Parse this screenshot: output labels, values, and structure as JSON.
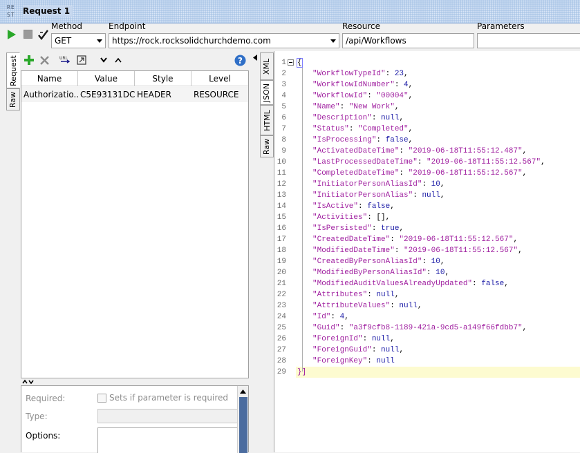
{
  "window": {
    "logo_lines": [
      "RE",
      "ST"
    ],
    "title": "Request 1"
  },
  "request_line": {
    "method_label": "Method",
    "method_value": "GET",
    "endpoint_label": "Endpoint",
    "endpoint_value": "https://rock.rocksolidchurchdemo.com",
    "resource_label": "Resource",
    "resource_value": "/api/Workflows",
    "parameters_label": "Parameters",
    "parameters_value": ""
  },
  "left_tabs": [
    "Request",
    "Raw"
  ],
  "params_grid": {
    "columns": [
      "Name",
      "Value",
      "Style",
      "Level"
    ],
    "rows": [
      [
        "Authorizatio...",
        "C5E93131DC...",
        "HEADER",
        "RESOURCE"
      ]
    ]
  },
  "property_panel": {
    "required_label": "Required:",
    "required_checkbox_label": "Sets if parameter is required",
    "type_label": "Type:",
    "options_label": "Options:"
  },
  "right_tabs": [
    "XML",
    "JSON",
    "HTML",
    "Raw"
  ],
  "editor": {
    "active_tab": "JSON",
    "line_numbers": [
      "1",
      "2",
      "3",
      "4",
      "5",
      "6",
      "7",
      "8",
      "9",
      "10",
      "11",
      "12",
      "13",
      "14",
      "15",
      "16",
      "17",
      "18",
      "19",
      "20",
      "21",
      "22",
      "23",
      "24",
      "25",
      "26",
      "27",
      "28",
      "29"
    ],
    "lines": [
      {
        "t": "open",
        "text": "{"
      },
      {
        "k": "\"WorkflowTypeId\"",
        "v": "23",
        "vt": "n"
      },
      {
        "k": "\"WorkflowIdNumber\"",
        "v": "4",
        "vt": "n"
      },
      {
        "k": "\"WorkflowId\"",
        "v": "\"00004\"",
        "vt": "s"
      },
      {
        "k": "\"Name\"",
        "v": "\"New Work\"",
        "vt": "s"
      },
      {
        "k": "\"Description\"",
        "v": "null",
        "vt": "n"
      },
      {
        "k": "\"Status\"",
        "v": "\"Completed\"",
        "vt": "s"
      },
      {
        "k": "\"IsProcessing\"",
        "v": "false",
        "vt": "n"
      },
      {
        "k": "\"ActivatedDateTime\"",
        "v": "\"2019-06-18T11:55:12.487\"",
        "vt": "s"
      },
      {
        "k": "\"LastProcessedDateTime\"",
        "v": "\"2019-06-18T11:55:12.567\"",
        "vt": "s"
      },
      {
        "k": "\"CompletedDateTime\"",
        "v": "\"2019-06-18T11:55:12.567\"",
        "vt": "s"
      },
      {
        "k": "\"InitiatorPersonAliasId\"",
        "v": "10",
        "vt": "n"
      },
      {
        "k": "\"InitiatorPersonAlias\"",
        "v": "null",
        "vt": "n"
      },
      {
        "k": "\"IsActive\"",
        "v": "false",
        "vt": "n"
      },
      {
        "k": "\"Activities\"",
        "v": "[]",
        "vt": "p"
      },
      {
        "k": "\"IsPersisted\"",
        "v": "true",
        "vt": "n"
      },
      {
        "k": "\"CreatedDateTime\"",
        "v": "\"2019-06-18T11:55:12.567\"",
        "vt": "s"
      },
      {
        "k": "\"ModifiedDateTime\"",
        "v": "\"2019-06-18T11:55:12.567\"",
        "vt": "s"
      },
      {
        "k": "\"CreatedByPersonAliasId\"",
        "v": "10",
        "vt": "n"
      },
      {
        "k": "\"ModifiedByPersonAliasId\"",
        "v": "10",
        "vt": "n"
      },
      {
        "k": "\"ModifiedAuditValuesAlreadyUpdated\"",
        "v": "false",
        "vt": "n"
      },
      {
        "k": "\"Attributes\"",
        "v": "null",
        "vt": "n"
      },
      {
        "k": "\"AttributeValues\"",
        "v": "null",
        "vt": "n"
      },
      {
        "k": "\"Id\"",
        "v": "4",
        "vt": "n"
      },
      {
        "k": "\"Guid\"",
        "v": "\"a3f9cfb8-1189-421a-9cd5-a149f66fdbb7\"",
        "vt": "s"
      },
      {
        "k": "\"ForeignId\"",
        "v": "null",
        "vt": "n"
      },
      {
        "k": "\"ForeignGuid\"",
        "v": "null",
        "vt": "n"
      },
      {
        "k": "\"ForeignKey\"",
        "v": "null",
        "vt": "n",
        "last": true
      },
      {
        "t": "close",
        "text": "}]"
      }
    ]
  },
  "colors": {
    "title_bar": "#a9c4e6",
    "json_key": "#a020a0",
    "json_literal": "#1a1aa6",
    "current_line": "#fdfbd0",
    "scroll_thumb": "#4b6c9f",
    "play": "#2aa82a"
  }
}
